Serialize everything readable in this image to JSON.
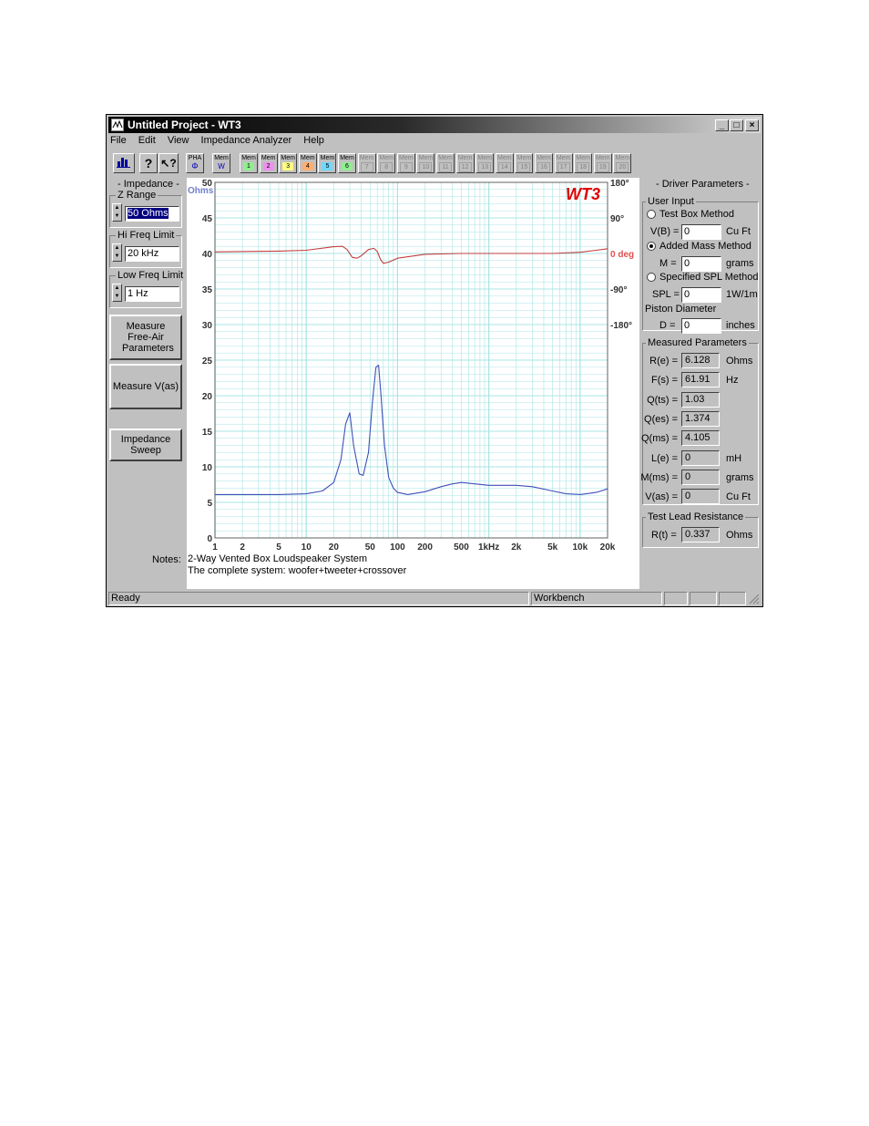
{
  "window": {
    "title": "Untitled Project - WT3"
  },
  "menu": [
    "File",
    "Edit",
    "View",
    "Impedance Analyzer",
    "Help"
  ],
  "toolbar": {
    "pha": {
      "top": "PHA",
      "bottom": "Φ"
    },
    "memw": {
      "top": "Mem",
      "bottom": "W"
    },
    "mem_label": "Mem",
    "mem_slots": [
      "1",
      "2",
      "3",
      "4",
      "5",
      "6",
      "7",
      "8",
      "9",
      "10",
      "11",
      "12",
      "13",
      "14",
      "15",
      "16",
      "17",
      "18",
      "19",
      "20"
    ],
    "mem_colors": [
      "#90ee90",
      "#ee90ee",
      "#ffff80",
      "#ffb070",
      "#70d8ff",
      "#90ee90"
    ]
  },
  "impedance": {
    "title": "- Impedance -",
    "z_range_label": "Z Range",
    "z_range_value": "50 Ohms",
    "hi_freq_label": "Hi Freq Limit",
    "hi_freq_value": "20 kHz",
    "low_freq_label": "Low Freq Limit",
    "low_freq_value": "1 Hz"
  },
  "buttons": {
    "measure_free_air": "Measure Free-Air Parameters",
    "measure_vas": "Measure V(as)",
    "impedance_sweep": "Impedance Sweep"
  },
  "driver": {
    "title": "- Driver Parameters -",
    "user_input_label": "User Input",
    "test_box": "Test Box Method",
    "vb_label": "V(B) =",
    "vb_value": "0",
    "vb_unit": "Cu Ft",
    "added_mass": "Added Mass Method",
    "m_label": "M =",
    "m_value": "0",
    "m_unit": "grams",
    "spl": "Specified SPL Method",
    "spl_label": "SPL =",
    "spl_value": "0",
    "spl_unit": "1W/1m",
    "piston_label": "Piston Diameter",
    "d_label": "D =",
    "d_value": "0",
    "d_unit": "inches"
  },
  "measured": {
    "title": "Measured Parameters",
    "rows": [
      {
        "label": "R(e) =",
        "value": "6.128",
        "unit": "Ohms"
      },
      {
        "label": "F(s) =",
        "value": "61.91",
        "unit": "Hz"
      },
      {
        "label": "Q(ts) =",
        "value": "1.03",
        "unit": ""
      },
      {
        "label": "Q(es) =",
        "value": "1.374",
        "unit": ""
      },
      {
        "label": "Q(ms) =",
        "value": "4.105",
        "unit": ""
      },
      {
        "label": "L(e) =",
        "value": "0",
        "unit": "mH"
      },
      {
        "label": "M(ms) =",
        "value": "0",
        "unit": "grams"
      },
      {
        "label": "V(as) =",
        "value": "0",
        "unit": "Cu Ft"
      }
    ]
  },
  "test_lead": {
    "title": "Test Lead Resistance",
    "label": "R(t) =",
    "value": "0.337",
    "unit": "Ohms"
  },
  "notes": {
    "label": "Notes:",
    "line1": "2-Way Vented Box Loudspeaker System",
    "line2": "The complete system: woofer+tweeter+crossover"
  },
  "status": {
    "left": "Ready",
    "mid": "Workbench"
  },
  "chart_data": {
    "type": "line",
    "watermark": "WT3",
    "ylabel": "Ohms",
    "ylim": [
      0,
      50
    ],
    "y_ticks": [
      0,
      5,
      10,
      15,
      20,
      25,
      30,
      35,
      40,
      45,
      50
    ],
    "y2_ticks": [
      {
        "value": 180,
        "label": "180°"
      },
      {
        "value": 90,
        "label": "90°"
      },
      {
        "value": 0,
        "label": "0 deg"
      },
      {
        "value": -90,
        "label": "-90°"
      },
      {
        "value": -180,
        "label": "-180°"
      }
    ],
    "xlim": [
      1,
      20000
    ],
    "x_scale": "log",
    "x_ticks": [
      {
        "value": 1,
        "label": "1"
      },
      {
        "value": 2,
        "label": "2"
      },
      {
        "value": 5,
        "label": "5"
      },
      {
        "value": 10,
        "label": "10"
      },
      {
        "value": 20,
        "label": "20"
      },
      {
        "value": 50,
        "label": "50"
      },
      {
        "value": 100,
        "label": "100"
      },
      {
        "value": 200,
        "label": "200"
      },
      {
        "value": 500,
        "label": "500"
      },
      {
        "value": 1000,
        "label": "1kHz"
      },
      {
        "value": 2000,
        "label": "2k"
      },
      {
        "value": 5000,
        "label": "5k"
      },
      {
        "value": 10000,
        "label": "10k"
      },
      {
        "value": 20000,
        "label": "20k"
      }
    ],
    "grid": true,
    "series": [
      {
        "axis": "impedance",
        "color": "#4050b8",
        "x": [
          1,
          5,
          10,
          15,
          20,
          24,
          27,
          30,
          33,
          38,
          42,
          48,
          53,
          58,
          62,
          66,
          72,
          80,
          90,
          100,
          130,
          200,
          300,
          400,
          500,
          700,
          1000,
          1500,
          2000,
          3000,
          5000,
          7000,
          10000,
          15000,
          20000
        ],
        "y": [
          6.1,
          6.1,
          6.2,
          6.6,
          7.8,
          11,
          16,
          17.6,
          13,
          9,
          8.8,
          12,
          19,
          24,
          24.3,
          20,
          13,
          8.5,
          7,
          6.4,
          6.1,
          6.5,
          7.2,
          7.6,
          7.8,
          7.6,
          7.4,
          7.4,
          7.4,
          7.2,
          6.6,
          6.2,
          6.1,
          6.4,
          6.9
        ]
      },
      {
        "axis": "phase",
        "color": "#c04040",
        "x": [
          1,
          5,
          10,
          20,
          25,
          28,
          32,
          36,
          40,
          48,
          55,
          60,
          65,
          70,
          80,
          100,
          200,
          500,
          1000,
          2000,
          5000,
          10000,
          15000,
          20000
        ],
        "y": [
          4,
          6,
          8,
          17,
          18,
          10,
          -10,
          -12,
          -6,
          10,
          13,
          5,
          -15,
          -25,
          -22,
          -12,
          -2,
          0,
          0,
          0,
          0,
          3,
          8,
          12
        ]
      }
    ]
  }
}
